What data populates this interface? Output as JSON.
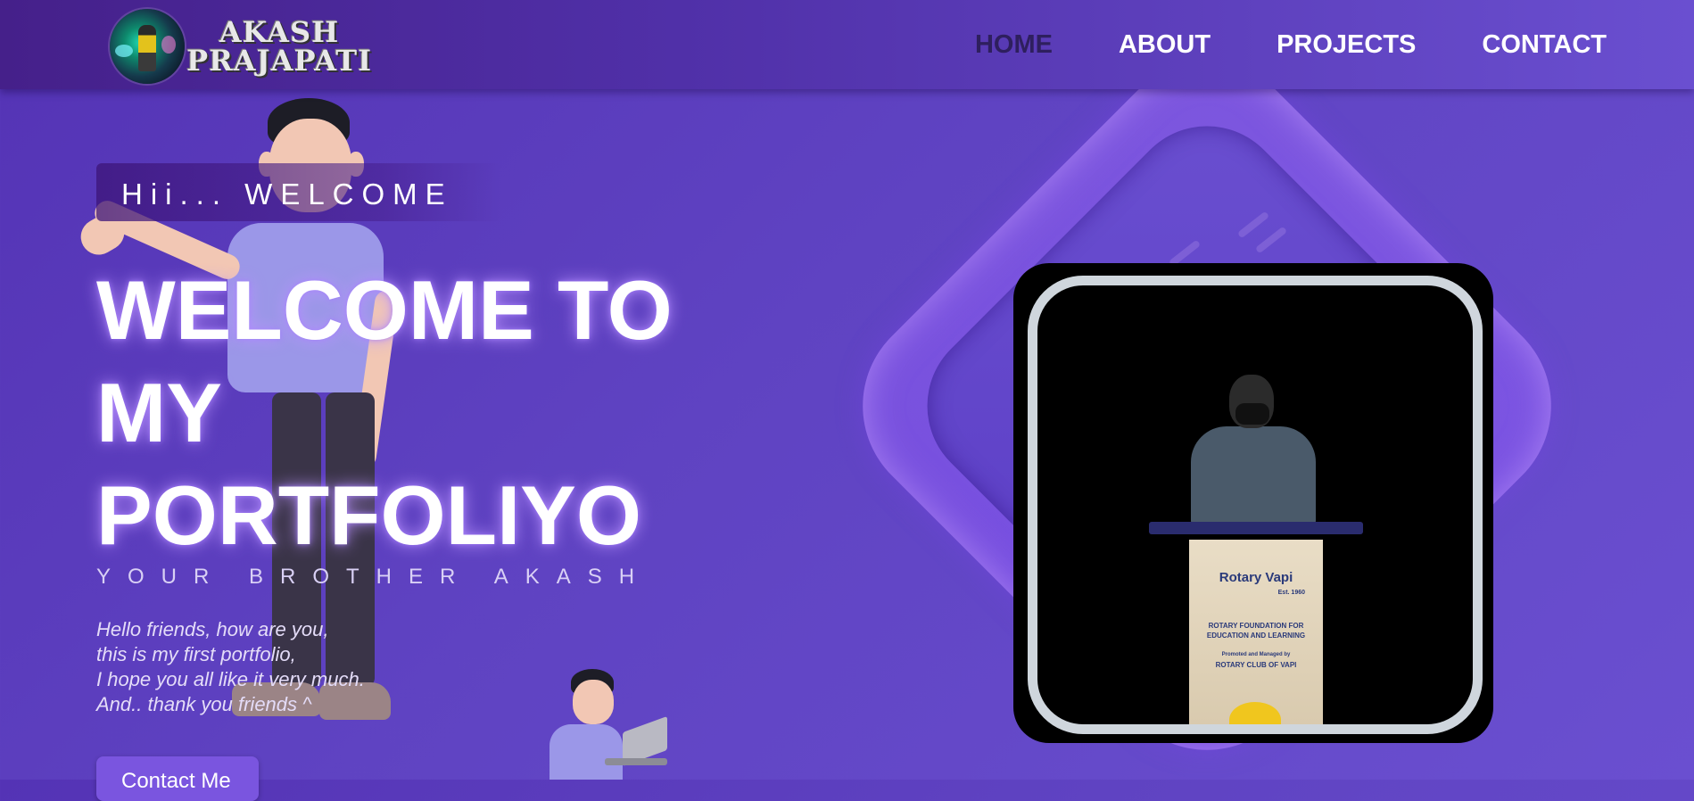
{
  "header": {
    "logo_line1": "AKASH",
    "logo_line2": "PRAJAPATI",
    "nav": [
      {
        "label": "HOME",
        "active": true
      },
      {
        "label": "ABOUT",
        "active": false
      },
      {
        "label": "PROJECTS",
        "active": false
      },
      {
        "label": "CONTACT",
        "active": false
      }
    ]
  },
  "hero": {
    "greeting": "Hii... WELCOME",
    "title_line1": "WELCOME TO",
    "title_line2": "MY",
    "title_line3": "PORTFOLIYO",
    "subtitle": "YOUR BROTHER AKASH",
    "paragraph": [
      "Hello friends, how are you,",
      "this is my first portfolio,",
      "I hope you all like it very much.",
      "And.. thank you friends ^"
    ],
    "contact_button": "Contact Me"
  },
  "photo": {
    "podium_brand": "Rotary Vapi",
    "podium_est": "Est. 1960",
    "podium_line1": "ROTARY FOUNDATION FOR",
    "podium_line2": "EDUCATION AND LEARNING",
    "podium_line3": "Promoted and Managed by",
    "podium_line4": "ROTARY CLUB OF VAPI"
  },
  "colors": {
    "background": "#5f43c2",
    "navbar": "#45208a",
    "active_nav": "#2e1f5e",
    "title_glow": "#be96ff"
  }
}
